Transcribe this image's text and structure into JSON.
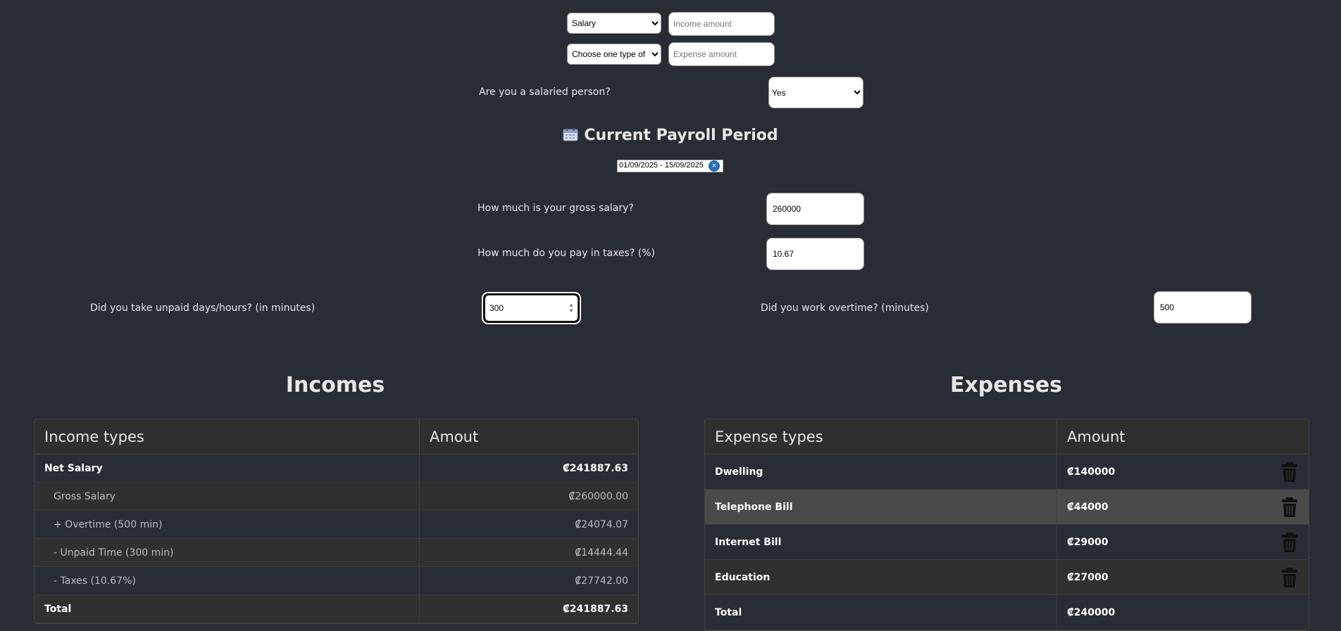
{
  "form": {
    "income_type_selected": "Salary",
    "income_amount_placeholder": "Income amount",
    "expense_type_selected": "Choose one type of expense",
    "expense_amount_placeholder": "Expense amount",
    "salaried_question": "Are you a salaried person?",
    "salaried_selected": "Yes"
  },
  "payroll": {
    "title": "Current Payroll Period",
    "date_range": "01/09/2025 - 15/09/2025",
    "clear_icon": "close-circle-icon",
    "calendar_icon": "calendar-icon"
  },
  "salary": {
    "gross_question": "How much is your gross salary?",
    "gross_value": "260000",
    "tax_question": "How much do you pay in taxes? (%)",
    "tax_value": "10.67",
    "unpaid_question": "Did you take unpaid days/hours? (in minutes)",
    "unpaid_value": "300",
    "overtime_question": "Did you work overtime? (minutes)",
    "overtime_value": "500"
  },
  "incomes": {
    "title": "Incomes",
    "headers": [
      "Income types",
      "Amout"
    ],
    "rows": [
      {
        "label": "Net Salary",
        "amount": "₡241887.63"
      },
      {
        "label": "Gross Salary",
        "amount": "₡260000.00"
      },
      {
        "label": "+ Overtime (500 min)",
        "amount": "₡24074.07"
      },
      {
        "label": "- Unpaid Time (300 min)",
        "amount": "₡14444.44"
      },
      {
        "label": "- Taxes (10.67%)",
        "amount": "₡27742.00"
      },
      {
        "label": "Total",
        "amount": "₡241887.63"
      }
    ]
  },
  "expenses": {
    "title": "Expenses",
    "headers": [
      "Expense types",
      "Amount"
    ],
    "rows": [
      {
        "label": "Dwelling",
        "amount": "₡140000"
      },
      {
        "label": "Telephone Bill",
        "amount": "₡44000"
      },
      {
        "label": "Internet Bill",
        "amount": "₡29000"
      },
      {
        "label": "Education",
        "amount": "₡27000"
      },
      {
        "label": "Total",
        "amount": "₡240000"
      }
    ],
    "delete_icon": "trash-icon"
  },
  "colors": {
    "background": "#282c34",
    "table_header": "#2f2f2f",
    "highlight_row": "#4a4a4a",
    "clear_button": "#2a6fb0"
  }
}
